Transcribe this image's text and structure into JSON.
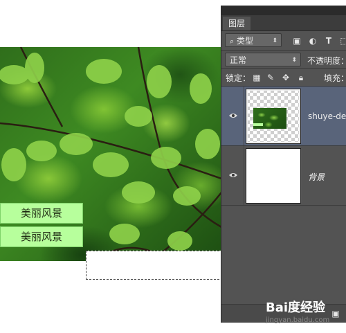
{
  "canvas": {
    "labels": [
      "美丽风景",
      "美丽风景"
    ]
  },
  "panel": {
    "tab_label": "图层",
    "filter_label": "类型",
    "blend_mode": "正常",
    "opacity_label": "不透明度：",
    "lock_label": "锁定：",
    "fill_label": "填充：",
    "layers": [
      {
        "name": "shuye-desk",
        "selected": true
      },
      {
        "name": "背景",
        "selected": false
      }
    ]
  },
  "watermark": {
    "logo": "Bai度经验",
    "url": "jingyan.baidu.com"
  },
  "colors": {
    "panel_bg": "#535353",
    "selected_layer": "#59647a",
    "text_box_fill": "#b7ff9c"
  }
}
